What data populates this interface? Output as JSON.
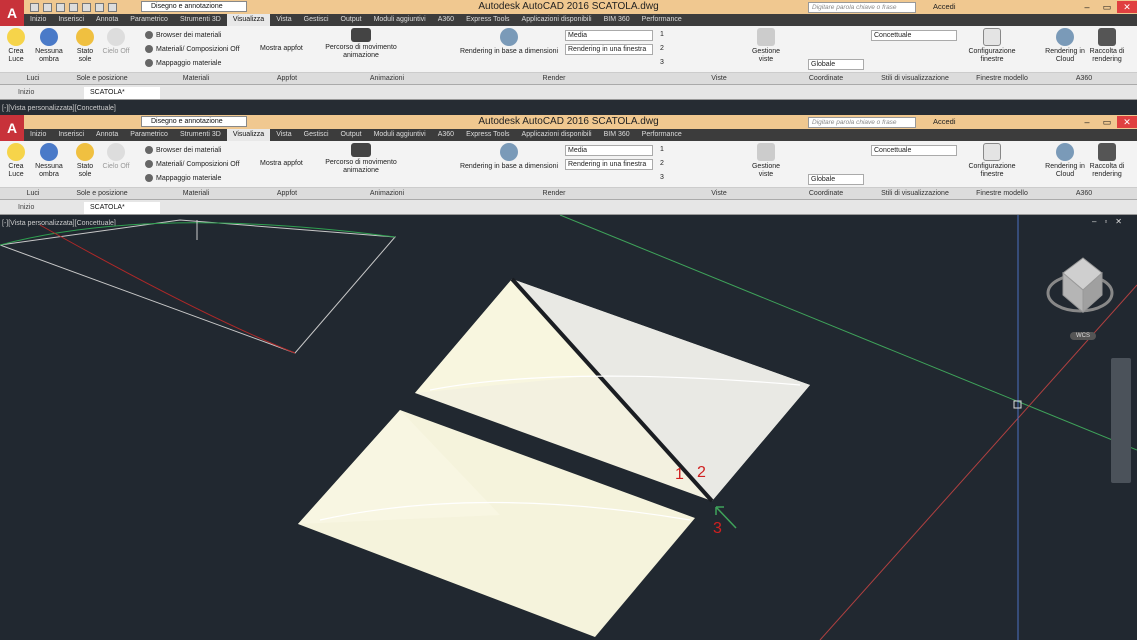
{
  "app": {
    "title": "Autodesk AutoCAD 2016    SCATOLA.dwg",
    "workspace": "Disegno e annotazione",
    "search_placeholder": "Digitare parola chiave o frase",
    "signin": "Accedi"
  },
  "ribbon_tabs": [
    "Inizio",
    "Inserisci",
    "Annota",
    "Parametrico",
    "Strumenti 3D",
    "Visualizza",
    "Vista",
    "Gestisci",
    "Output",
    "Moduli aggiuntivi",
    "A360",
    "Express Tools",
    "Applicazioni disponibili",
    "BIM 360",
    "Performance"
  ],
  "active_tab": "Visualizza",
  "buttons": {
    "crea_luce": "Crea Luce",
    "nessuna_ombra": "Nessuna ombra",
    "stato_sole": "Stato sole",
    "cielo_off": "Cielo Off",
    "browser_materiali": "Browser dei materiali",
    "materiali_composizioni": "Materiali/ Composizioni Off",
    "mappaggio_materiale": "Mappaggio materiale",
    "mostra_appfot": "Mostra  appfot",
    "percorso": "Percorso di movimento animazione",
    "rendering_dim": "Rendering in base a dimensioni",
    "gestione_viste": "Gestione viste",
    "config_finestre": "Configurazione finestre",
    "rendering_cloud": "Rendering in Cloud",
    "raccolta_rendering": "Raccolta di rendering"
  },
  "combos": {
    "quality": "Media",
    "render_target": "Rendering in una finestra",
    "visual_style": "Concettuale",
    "ucs": "Globale",
    "views": [
      "1",
      "2",
      "3"
    ]
  },
  "panels": [
    "Luci",
    "Sole e posizione",
    "Materiali",
    "Appfot",
    "Animazioni",
    "Render",
    "Viste",
    "Coordinate",
    "Stili di visualizzazione",
    "Finestre modello",
    "A360"
  ],
  "doc_tabs": [
    "Inizio",
    "SCATOLA*"
  ],
  "viewport": {
    "label": "[-][Vista personalizzata][Concettuale]",
    "wcs": "WCS",
    "annotations": [
      "1",
      "2",
      "3"
    ]
  },
  "colors": {
    "accent": "#c8323a",
    "viewport_bg": "#212830",
    "titlebar": "#f0c890",
    "annotation": "#d02020"
  }
}
